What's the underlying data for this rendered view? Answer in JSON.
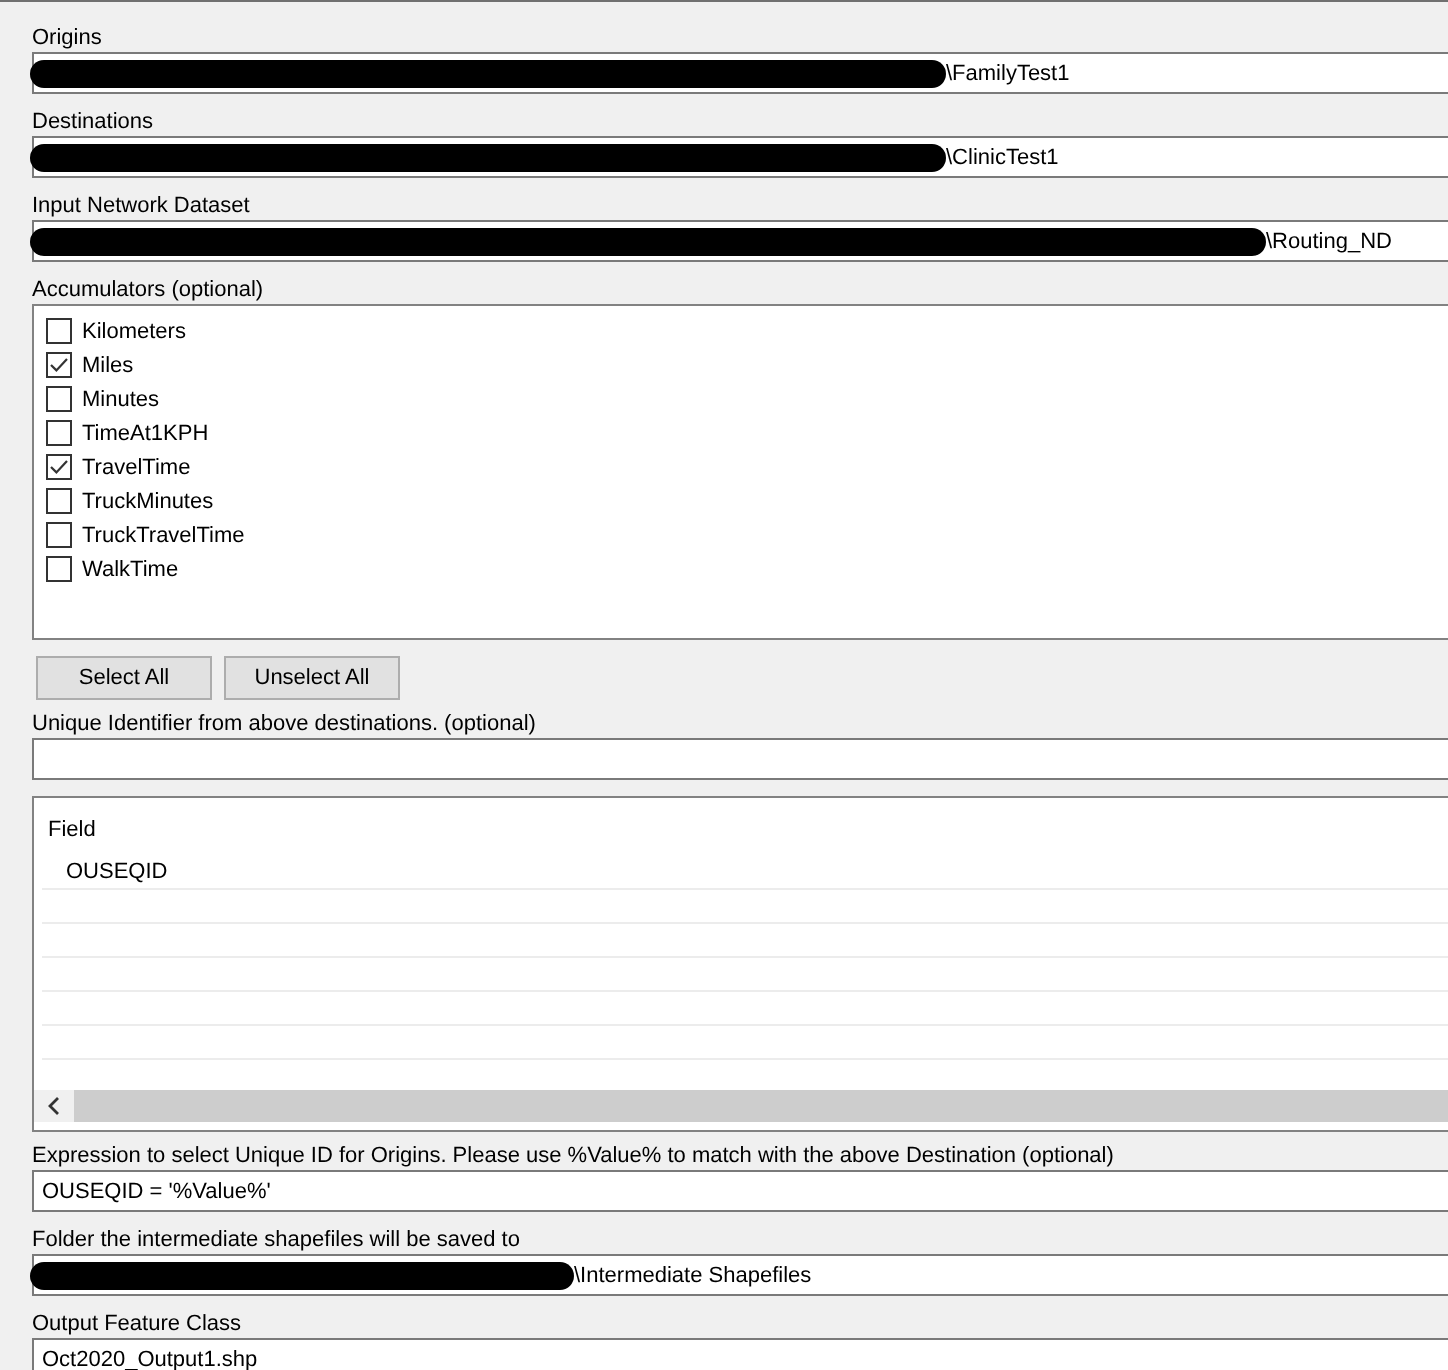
{
  "origins": {
    "label": "Origins",
    "value": "\\FamilyTest1",
    "redacted": true
  },
  "destinations": {
    "label": "Destinations",
    "value": "\\ClinicTest1",
    "redacted": true
  },
  "network": {
    "label": "Input Network Dataset",
    "value": "\\Routing_ND",
    "redacted": true
  },
  "accumulators": {
    "label": "Accumulators (optional)",
    "items": [
      {
        "label": "Kilometers",
        "checked": false
      },
      {
        "label": "Miles",
        "checked": true
      },
      {
        "label": "Minutes",
        "checked": false
      },
      {
        "label": "TimeAt1KPH",
        "checked": false
      },
      {
        "label": "TravelTime",
        "checked": true
      },
      {
        "label": "TruckMinutes",
        "checked": false
      },
      {
        "label": "TruckTravelTime",
        "checked": false
      },
      {
        "label": "WalkTime",
        "checked": false
      }
    ]
  },
  "buttons": [
    "Select All",
    "Unselect All"
  ],
  "unique": {
    "label": "Unique Identifier from above destinations. (optional)"
  },
  "table": {
    "columns": [
      "Field"
    ],
    "rows": [
      [
        "OUSEQID"
      ]
    ]
  },
  "expression": {
    "label": "Expression to select Unique ID for Origins.  Please use %Value% to match with the above Destination (optional)",
    "value": "OUSEQID = '%Value%'"
  },
  "folder": {
    "label": "Folder the intermediate shapefiles will be saved to",
    "value": "\\Intermediate Shapefiles",
    "redacted": true
  },
  "output": {
    "label": "Output Feature Class",
    "value": "Oct2020_Output1.shp"
  }
}
